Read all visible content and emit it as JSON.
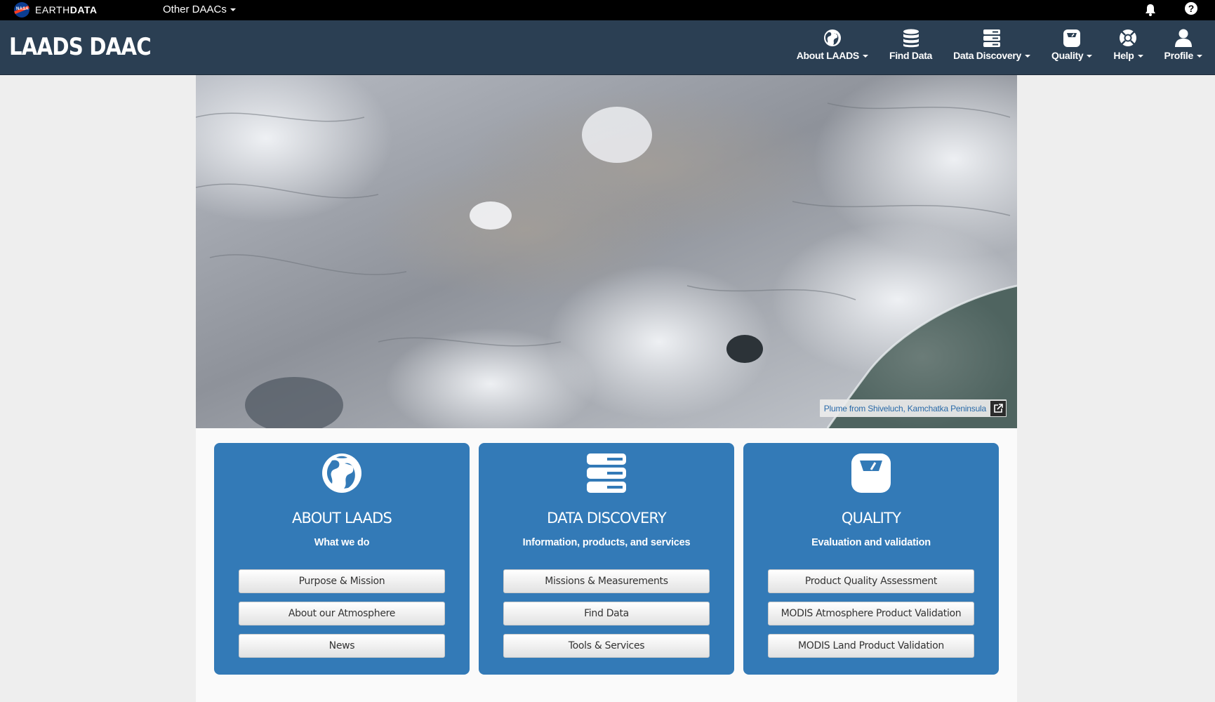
{
  "earthdata_bar": {
    "logo_text": "NASA",
    "brand_prefix": "EARTH",
    "brand_bold": "DATA",
    "other_daacs": "Other DAACs",
    "help_glyph": "?"
  },
  "header": {
    "site_title": "LAADS DAAC",
    "nav": [
      {
        "label": "About LAADS",
        "icon": "globe-icon",
        "dropdown": true
      },
      {
        "label": "Find Data",
        "icon": "database-icon",
        "dropdown": false
      },
      {
        "label": "Data Discovery",
        "icon": "server-icon",
        "dropdown": true
      },
      {
        "label": "Quality",
        "icon": "scale-icon",
        "dropdown": true
      },
      {
        "label": "Help",
        "icon": "lifebuoy-icon",
        "dropdown": true
      },
      {
        "label": "Profile",
        "icon": "user-icon",
        "dropdown": true
      }
    ]
  },
  "hero": {
    "caption": "Plume from Shiveluch, Kamchatka Peninsula"
  },
  "cards": [
    {
      "title": "ABOUT LAADS",
      "subtitle": "What we do",
      "icon": "globe-icon",
      "buttons": [
        "Purpose & Mission",
        "About our Atmosphere",
        "News"
      ]
    },
    {
      "title": "DATA DISCOVERY",
      "subtitle": "Information, products, and services",
      "icon": "server-icon",
      "buttons": [
        "Missions & Measurements",
        "Find Data",
        "Tools & Services"
      ]
    },
    {
      "title": "QUALITY",
      "subtitle": "Evaluation and validation",
      "icon": "scale-icon",
      "buttons": [
        "Product Quality Assessment",
        "MODIS Atmosphere Product Validation",
        "MODIS Land Product Validation"
      ]
    }
  ],
  "colors": {
    "top_bar": "#000000",
    "header": "#2b3f53",
    "card": "#337ab7",
    "page_bg": "#eeeeee"
  }
}
